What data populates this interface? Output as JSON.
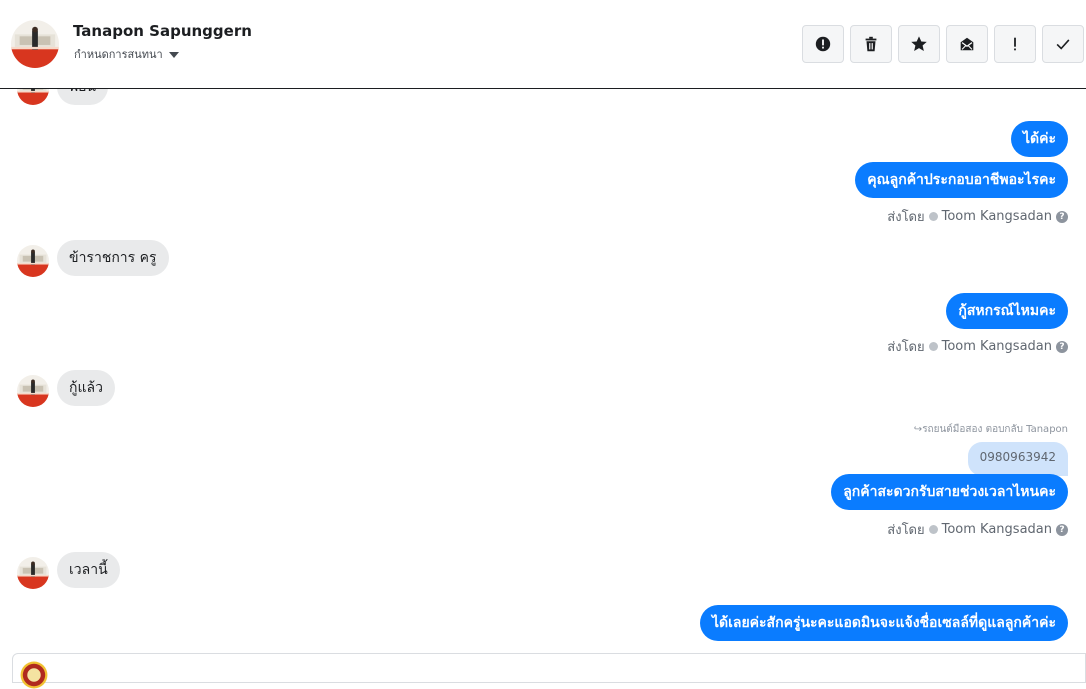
{
  "header": {
    "name": "Tanapon Sapunggern",
    "assign_label": "กำหนดการสนทนา"
  },
  "actions": [
    {
      "icon": "alert-circle-icon",
      "label": "!"
    },
    {
      "icon": "trash-icon"
    },
    {
      "icon": "star-icon"
    },
    {
      "icon": "mark-unread-icon"
    },
    {
      "icon": "exclamation-icon",
      "label": "!"
    },
    {
      "icon": "checkmark-icon"
    }
  ],
  "messages": {
    "m0_partial": "พี่ยัน",
    "m1": "ได้ค่ะ",
    "m2": "คุณลูกค้าประกอบอาชีพอะไรคะ",
    "m3": "ข้าราชการ ครู",
    "m4": "กู้สหกรณ์ไหมคะ",
    "m5": "กู้แล้ว",
    "m6_quote": "0980963942",
    "m6": "ลูกค้าสะดวกรับสายช่วงเวลาไหนคะ",
    "m7": "เวลานี้",
    "m8": "ได้เลยค่ะสักครู่นะคะแอดมินจะแจ้งชื่อเซลล์ที่ดูแลลูกค้าค่ะ"
  },
  "meta": {
    "sent_by_label": "ส่งโดย",
    "agent": "Toom Kangsadan",
    "help": "?"
  },
  "reply_note": {
    "prefix": "รถยนต์มือสอง ตอบกลับ",
    "to": "Tanapon"
  },
  "colors": {
    "out_bubble": "#0a7cff",
    "in_bubble": "#e9eaeb",
    "quoted_bubble": "#cfe3fb"
  }
}
